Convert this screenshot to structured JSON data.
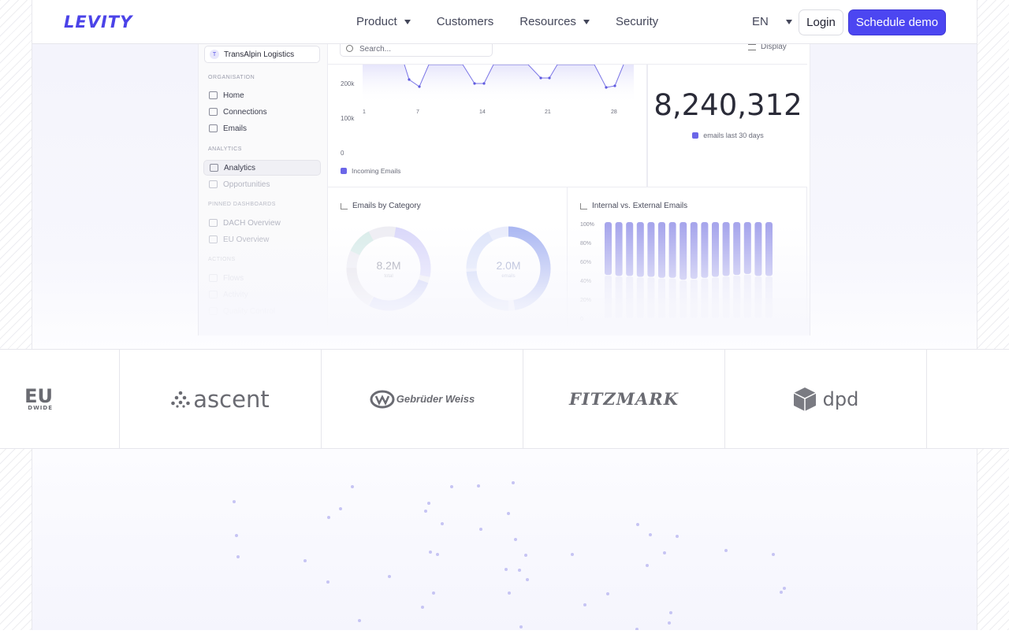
{
  "nav": {
    "logo": "LEVITY",
    "links": [
      "Product",
      "Customers",
      "Resources",
      "Security"
    ],
    "language": "EN",
    "login": "Login",
    "cta": "Schedule demo"
  },
  "app": {
    "org_name": "TransAlpin Logistics",
    "org_initial": "T",
    "search_placeholder": "Search...",
    "display_label": "Display",
    "sections": {
      "organisation": "ORGANISATION",
      "analytics": "ANALYTICS",
      "pinned": "PINNED DASHBOARDS",
      "actions": "ACTIONS"
    },
    "org_items": [
      "Home",
      "Connections",
      "Emails"
    ],
    "analytics_items": [
      "Analytics",
      "Opportunities"
    ],
    "pinned_items": [
      "DACH Overview",
      "EU Overview"
    ],
    "action_items": [
      "Flows",
      "Activity",
      "Quality Control"
    ],
    "stat_value": "8,240,312",
    "stat_label": "emails last 30 days",
    "line_legend": "Incoming Emails",
    "category_title": "Emails by Category",
    "donut1_value": "8.2M",
    "donut1_label": "total",
    "donut2_value": "2.0M",
    "donut2_label": "emails",
    "ratio_title": "Internal vs. External Emails"
  },
  "chart_data": [
    {
      "type": "line",
      "series": [
        {
          "name": "Incoming Emails"
        }
      ],
      "x": [
        1,
        7,
        14,
        21,
        28
      ],
      "y_ticks": [
        "200k",
        "100k",
        "0"
      ]
    },
    {
      "type": "bar",
      "title": "Internal vs. External Emails",
      "y_ticks": [
        "100%",
        "80%",
        "60%",
        "40%",
        "20%",
        "0"
      ],
      "values": [
        45,
        44,
        44,
        43,
        43,
        42,
        42,
        40,
        41,
        42,
        43,
        44,
        45,
        46,
        44,
        44
      ]
    }
  ],
  "logos": [
    "ascent",
    "Gebrüder Weiss",
    "FITZMARK",
    "dpd"
  ],
  "colors": {
    "accent": "#4c46f1",
    "chart": "#6b66e8"
  }
}
